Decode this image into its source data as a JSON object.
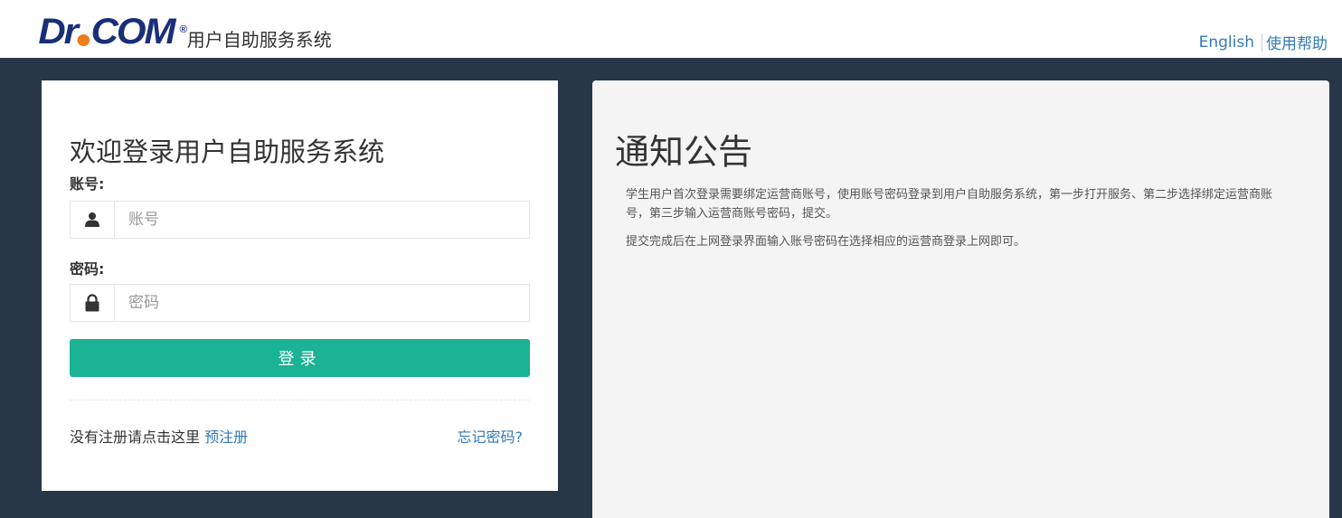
{
  "header": {
    "logo_text_left": "Dr",
    "logo_text_right": "COM",
    "logo_reg": "®",
    "system_name": "用户自助服务系统",
    "lang_link": "English",
    "help_link": "使用帮助"
  },
  "login": {
    "title": "欢迎登录用户自助服务系统",
    "account_label": "账号:",
    "account_placeholder": "账号",
    "password_label": "密码:",
    "password_placeholder": "密码",
    "submit_label": "登录",
    "register_prompt": "没有注册请点击这里",
    "register_link": "预注册",
    "forgot_link": "忘记密码?"
  },
  "notice": {
    "title": "通知公告",
    "paragraphs": [
      "学生用户首次登录需要绑定运营商账号，使用账号密码登录到用户自助服务系统，第一步打开服务、第二步选择绑定运营商账号，第三步输入运营商账号密码，提交。",
      "提交完成后在上网登录界面输入账号密码在选择相应的运营商登录上网即可。"
    ]
  },
  "colors": {
    "background": "#283747",
    "primary_button": "#1ab394",
    "link": "#337ab7",
    "logo_blue": "#1a2f7a",
    "logo_orange": "#ef7d1a"
  },
  "icons": {
    "account": "user-icon",
    "password": "lock-icon"
  }
}
